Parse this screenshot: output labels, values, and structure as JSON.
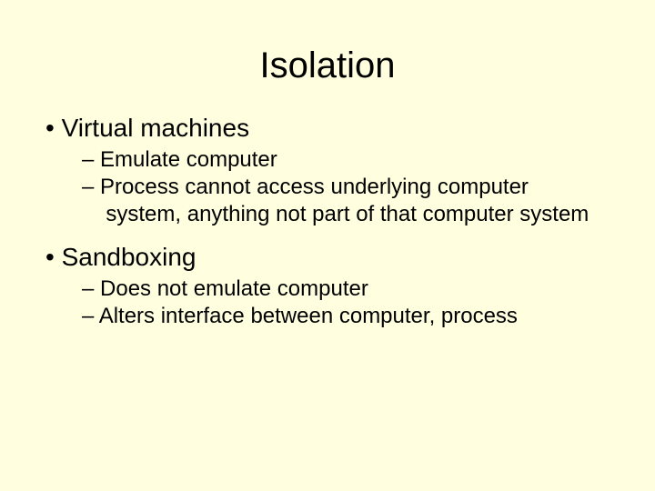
{
  "title": "Isolation",
  "bullets": [
    {
      "text": "Virtual machines",
      "sub": [
        "Emulate computer",
        "Process cannot access underlying computer system, anything not part of that computer system"
      ]
    },
    {
      "text": "Sandboxing",
      "sub": [
        "Does not emulate computer",
        "Alters interface between computer, process"
      ]
    }
  ]
}
